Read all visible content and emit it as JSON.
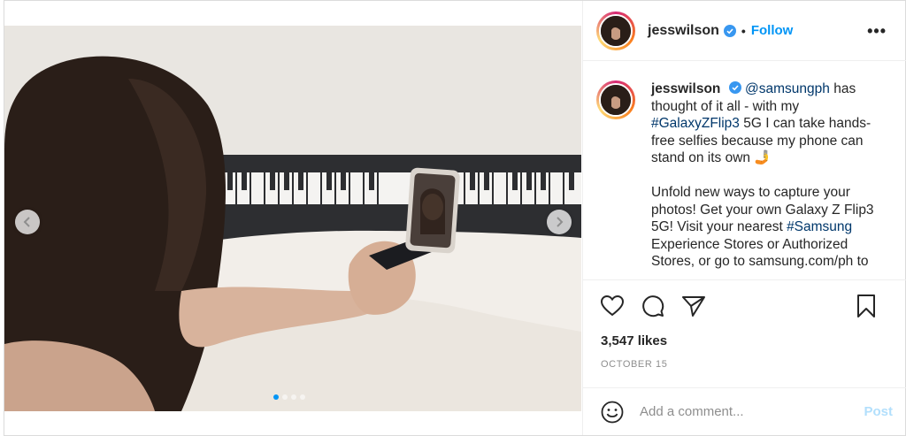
{
  "post": {
    "username": "jesswilson",
    "follow_label": "Follow",
    "separator": "•",
    "more_label": "•••",
    "caption": {
      "username": "jesswilson",
      "mention": "@samsungph",
      "part1": " has thought of it all - with my ",
      "hashtag1": "#GalaxyZFlip3",
      "part2": " 5G I can take hands-free selfies because my phone can stand on its own 🤳",
      "para2_part1": "Unfold new ways to capture your photos! Get your own Galaxy Z Flip3 5G! Visit your nearest ",
      "hashtag2": "#Samsung",
      "para2_part2": " Experience Stores or Authorized Stores, or go to samsung.com/ph to"
    },
    "likes": "3,547 likes",
    "date": "OCTOBER 15",
    "comment_placeholder": "Add a comment...",
    "post_label": "Post",
    "carousel": {
      "total": 4,
      "active_index": 0
    }
  },
  "colors": {
    "accent": "#0095f6",
    "link": "#00376b",
    "post_disabled": "#b2dffc"
  },
  "icons": [
    "chevron-left-icon",
    "chevron-right-icon",
    "verified-badge-icon",
    "heart-icon",
    "comment-icon",
    "share-icon",
    "bookmark-icon",
    "emoji-icon",
    "more-options-icon"
  ]
}
